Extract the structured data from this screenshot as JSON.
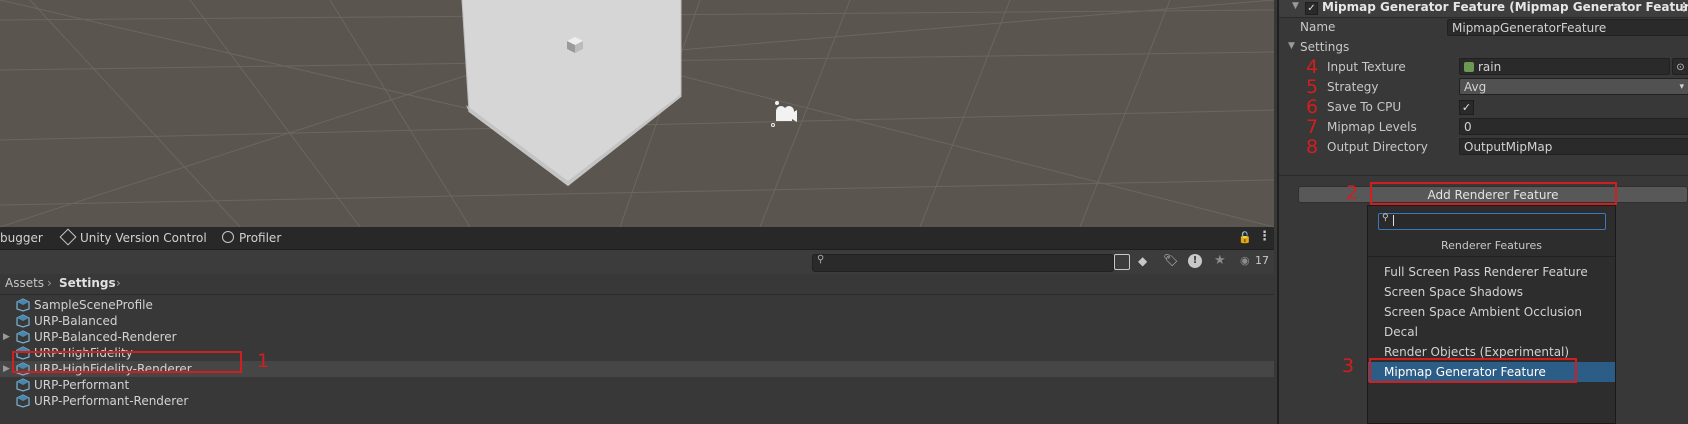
{
  "project": {
    "tabs": [
      {
        "label": "bugger",
        "icon": ""
      },
      {
        "label": "Unity Version Control",
        "icon": "version-control-icon"
      },
      {
        "label": "Profiler",
        "icon": "profiler-icon"
      }
    ],
    "visible_count": "17",
    "breadcrumb": {
      "root": "Assets",
      "current": "Settings"
    },
    "items": [
      {
        "label": "SampleSceneProfile",
        "icon": "volume-profile-icon",
        "expandable": false,
        "selected": false
      },
      {
        "label": "URP-Balanced",
        "icon": "urp-asset-icon",
        "expandable": false,
        "selected": false
      },
      {
        "label": "URP-Balanced-Renderer",
        "icon": "renderer-data-icon",
        "expandable": true,
        "selected": false
      },
      {
        "label": "URP-HighFidelity",
        "icon": "urp-asset-icon",
        "expandable": false,
        "selected": false
      },
      {
        "label": "URP-HighFidelity-Renderer",
        "icon": "renderer-data-icon",
        "expandable": true,
        "selected": true
      },
      {
        "label": "URP-Performant",
        "icon": "urp-asset-icon",
        "expandable": false,
        "selected": false
      },
      {
        "label": "URP-Performant-Renderer",
        "icon": "renderer-data-icon",
        "expandable": false,
        "selected": false
      }
    ]
  },
  "inspector": {
    "feature_header": "Mipmap Generator Feature (Mipmap Generator Featur",
    "feature_enabled": true,
    "name_label": "Name",
    "name_value": "MipmapGeneratorFeature",
    "settings_label": "Settings",
    "fields": {
      "input_texture": {
        "label": "Input Texture",
        "value": "rain"
      },
      "strategy": {
        "label": "Strategy",
        "value": "Avg"
      },
      "save_to_cpu": {
        "label": "Save To CPU",
        "checked": true
      },
      "mipmap_levels": {
        "label": "Mipmap Levels",
        "value": "0"
      },
      "output_directory": {
        "label": "Output Directory",
        "value": "OutputMipMap"
      }
    },
    "add_button_label": "Add Renderer Feature"
  },
  "dropdown": {
    "search_value": "",
    "header": "Renderer Features",
    "items": [
      {
        "label": "Full Screen Pass Renderer Feature",
        "selected": false
      },
      {
        "label": "Screen Space Shadows",
        "selected": false
      },
      {
        "label": "Screen Space Ambient Occlusion",
        "selected": false
      },
      {
        "label": "Decal",
        "selected": false
      },
      {
        "label": "Render Objects (Experimental)",
        "selected": false
      },
      {
        "label": "Mipmap Generator Feature",
        "selected": true
      }
    ]
  },
  "annotations": {
    "step_1": "1",
    "step_2": "2",
    "step_3": "3",
    "step_4": "4",
    "step_5": "5",
    "step_6": "6",
    "step_7": "7",
    "step_8": "8",
    "color": "#d11f1f"
  },
  "colors": {
    "selection": "#2c5d87",
    "scene_bg": "#5b5550",
    "panel_bg": "#383838"
  }
}
